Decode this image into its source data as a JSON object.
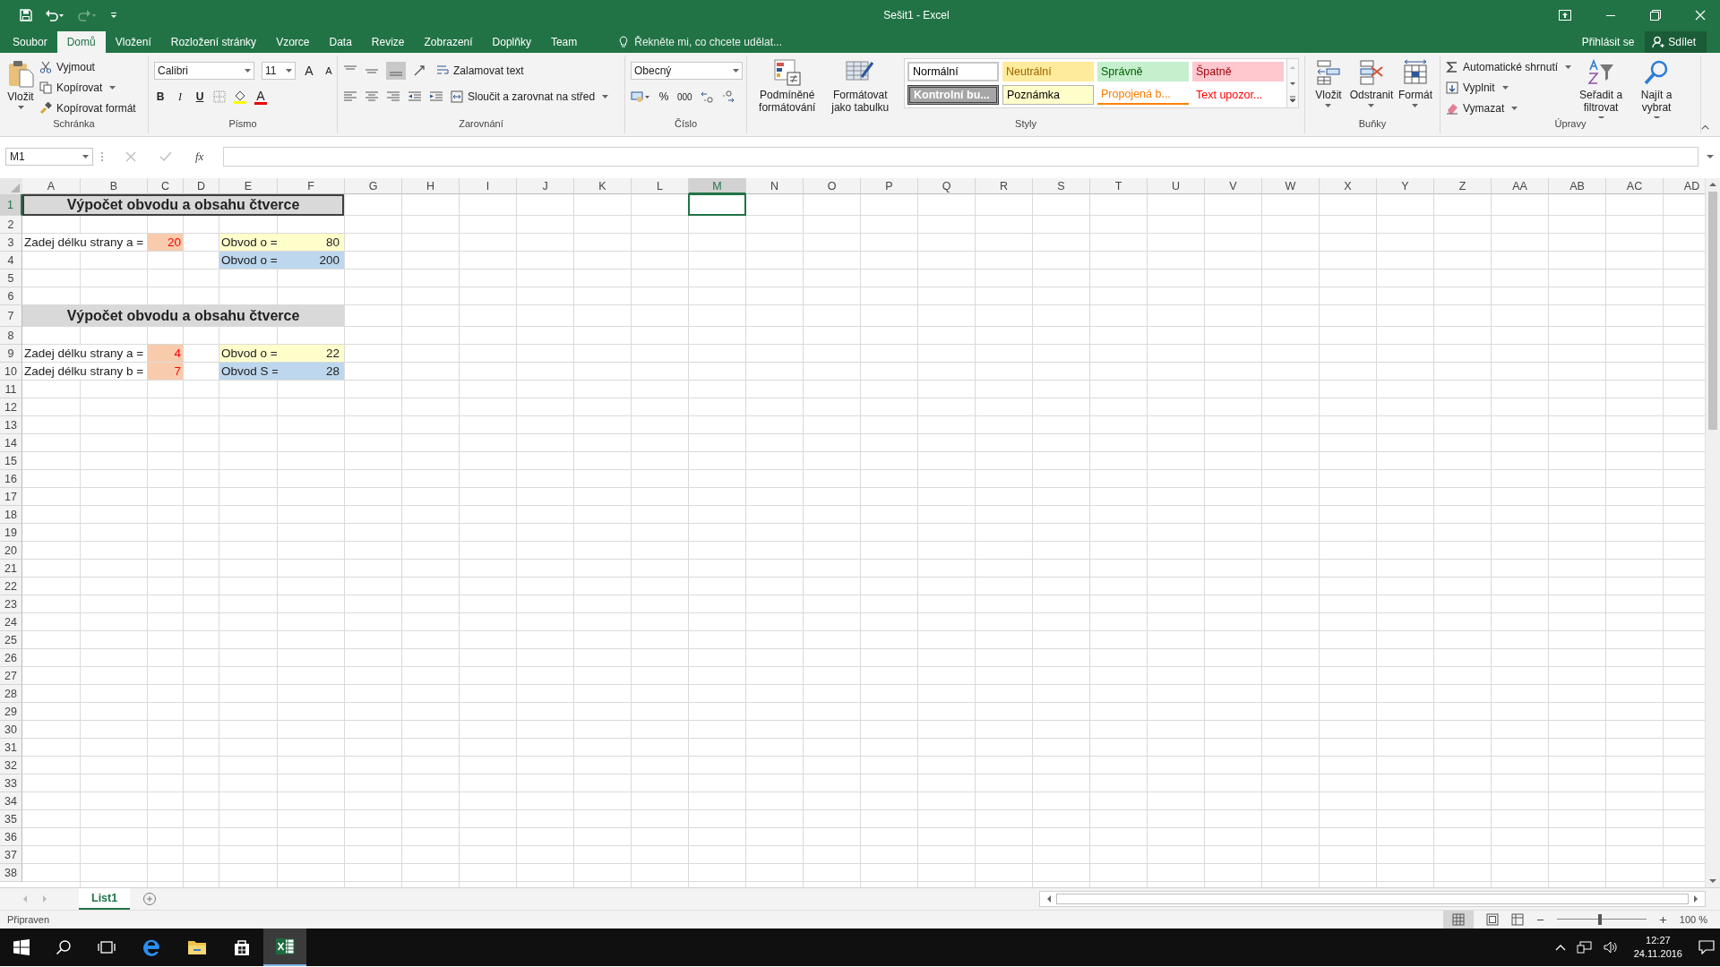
{
  "window": {
    "title": "Sešit1 - Excel"
  },
  "tabs": [
    {
      "label": "Soubor",
      "selected": false
    },
    {
      "label": "Domů",
      "selected": true
    },
    {
      "label": "Vložení",
      "selected": false
    },
    {
      "label": "Rozložení stránky",
      "selected": false
    },
    {
      "label": "Vzorce",
      "selected": false
    },
    {
      "label": "Data",
      "selected": false
    },
    {
      "label": "Revize",
      "selected": false
    },
    {
      "label": "Zobrazení",
      "selected": false
    },
    {
      "label": "Doplňky",
      "selected": false
    },
    {
      "label": "Team",
      "selected": false
    }
  ],
  "tell_me": {
    "placeholder": "Řekněte mi, co chcete udělat..."
  },
  "account": {
    "sign_in": "Přihlásit se",
    "share": "Sdílet"
  },
  "ribbon": {
    "clipboard": {
      "label": "Schránka",
      "paste": "Vložit",
      "cut": "Vyjmout",
      "copy": "Kopírovat",
      "format_painter": "Kopírovat formát"
    },
    "font": {
      "label": "Písmo",
      "font": "Calibri",
      "size": "11",
      "grow": "A",
      "shrink": "A",
      "bold": "B",
      "italic": "I",
      "underline": "U",
      "font_color": "A"
    },
    "alignment": {
      "label": "Zarovnání",
      "wrap": "Zalamovat text",
      "merge": "Sloučit a zarovnat na střed"
    },
    "number": {
      "label": "Číslo",
      "format": "Obecný",
      "percent": "%",
      "thousands": "000"
    },
    "styles": {
      "label": "Styly",
      "conditional": "Podmíněné formátování",
      "as_table": "Formátovat jako tabulku",
      "cell_styles": [
        {
          "label": "Normální",
          "kind": "normal"
        },
        {
          "label": "Neutrální",
          "kind": "neutral"
        },
        {
          "label": "Správně",
          "kind": "good"
        },
        {
          "label": "Špatně",
          "kind": "bad"
        },
        {
          "label": "Kontrolní bu...",
          "kind": "check"
        },
        {
          "label": "Poznámka",
          "kind": "note"
        },
        {
          "label": "Propojená b...",
          "kind": "linked"
        },
        {
          "label": "Text upozor...",
          "kind": "warning"
        }
      ]
    },
    "cells": {
      "label": "Buňky",
      "insert": "Vložit",
      "delete": "Odstranit",
      "format": "Formát"
    },
    "editing": {
      "label": "Úpravy",
      "autosum": "Automatické shrnutí",
      "fill": "Vyplnit",
      "clear": "Vymazat",
      "sort": "Seřadit a filtrovat",
      "find": "Najít a vybrat"
    }
  },
  "formula_bar": {
    "name_box": "M1",
    "fx": "fx"
  },
  "sheet": {
    "columns": [
      {
        "label": "A",
        "selected": false
      },
      {
        "label": "B",
        "selected": false
      },
      {
        "label": "C",
        "selected": false
      },
      {
        "label": "D",
        "selected": false
      },
      {
        "label": "E",
        "selected": false
      },
      {
        "label": "F",
        "selected": false
      },
      {
        "label": "G",
        "selected": false
      },
      {
        "label": "H",
        "selected": false
      },
      {
        "label": "I",
        "selected": false
      },
      {
        "label": "J",
        "selected": false
      },
      {
        "label": "K",
        "selected": false
      },
      {
        "label": "L",
        "selected": false
      },
      {
        "label": "M",
        "selected": true
      },
      {
        "label": "N",
        "selected": false
      },
      {
        "label": "O",
        "selected": false
      },
      {
        "label": "P",
        "selected": false
      },
      {
        "label": "Q",
        "selected": false
      },
      {
        "label": "R",
        "selected": false
      },
      {
        "label": "S",
        "selected": false
      },
      {
        "label": "T",
        "selected": false
      },
      {
        "label": "U",
        "selected": false
      },
      {
        "label": "V",
        "selected": false
      },
      {
        "label": "W",
        "selected": false
      },
      {
        "label": "X",
        "selected": false
      },
      {
        "label": "Y",
        "selected": false
      },
      {
        "label": "Z",
        "selected": false
      },
      {
        "label": "AA",
        "selected": false
      },
      {
        "label": "AB",
        "selected": false
      },
      {
        "label": "AC",
        "selected": false
      },
      {
        "label": "AD",
        "selected": false
      }
    ],
    "rows": [
      {
        "number": "1",
        "selected": true,
        "cells": [
          {
            "kind": "heading",
            "framed": true,
            "text": "Výpočet obvodu a obsahu čtverce"
          }
        ]
      },
      {
        "number": "2",
        "selected": false
      },
      {
        "number": "3",
        "selected": false,
        "cells": [
          {
            "kind": "prompt",
            "text": "Zadej délku strany a ="
          },
          {
            "kind": "input",
            "text": "20"
          },
          {
            "kind": "result_name",
            "text": "Obvod o =",
            "color": "#ffffcc"
          },
          {
            "kind": "result_value",
            "text": "80",
            "color": "#ffffcc"
          }
        ]
      },
      {
        "number": "4",
        "selected": false,
        "cells": [
          {
            "kind": "result_name",
            "text": "Obvod o =",
            "color": "#bdd7ee"
          },
          {
            "kind": "result_value",
            "text": "200",
            "color": "#bdd7ee"
          }
        ]
      },
      {
        "number": "5",
        "selected": false
      },
      {
        "number": "6",
        "selected": false
      },
      {
        "number": "7",
        "selected": false,
        "cells": [
          {
            "kind": "heading",
            "framed": false,
            "text": "Výpočet obvodu a obsahu čtverce"
          }
        ]
      },
      {
        "number": "8",
        "selected": false
      },
      {
        "number": "9",
        "selected": false,
        "cells": [
          {
            "kind": "prompt",
            "text": "Zadej délku strany a ="
          },
          {
            "kind": "input",
            "text": "4"
          },
          {
            "kind": "result_name",
            "text": "Obvod o =",
            "color": "#ffffcc"
          },
          {
            "kind": "result_value",
            "text": "22",
            "color": "#ffffcc"
          }
        ]
      },
      {
        "number": "10",
        "selected": false,
        "cells": [
          {
            "kind": "prompt",
            "text": "Zadej délku strany b ="
          },
          {
            "kind": "input",
            "text": "7"
          },
          {
            "kind": "result_name",
            "text": "Obvod S =",
            "color": "#bdd7ee"
          },
          {
            "kind": "result_value",
            "text": "28",
            "color": "#bdd7ee"
          }
        ]
      },
      {
        "number": "11",
        "selected": false
      },
      {
        "number": "12",
        "selected": false
      },
      {
        "number": "13",
        "selected": false
      },
      {
        "number": "14",
        "selected": false
      },
      {
        "number": "15",
        "selected": false
      },
      {
        "number": "16",
        "selected": false
      },
      {
        "number": "17",
        "selected": false
      },
      {
        "number": "18",
        "selected": false
      },
      {
        "number": "19",
        "selected": false
      },
      {
        "number": "20",
        "selected": false
      },
      {
        "number": "21",
        "selected": false
      },
      {
        "number": "22",
        "selected": false
      },
      {
        "number": "23",
        "selected": false
      },
      {
        "number": "24",
        "selected": false
      },
      {
        "number": "25",
        "selected": false
      },
      {
        "number": "26",
        "selected": false
      },
      {
        "number": "27",
        "selected": false
      },
      {
        "number": "28",
        "selected": false
      },
      {
        "number": "29",
        "selected": false
      },
      {
        "number": "30",
        "selected": false
      },
      {
        "number": "31",
        "selected": false
      },
      {
        "number": "32",
        "selected": false
      },
      {
        "number": "33",
        "selected": false
      },
      {
        "number": "34",
        "selected": false
      },
      {
        "number": "35",
        "selected": false
      },
      {
        "number": "36",
        "selected": false
      },
      {
        "number": "37",
        "selected": false
      },
      {
        "number": "38",
        "selected": false
      }
    ]
  },
  "sheet_tabs": [
    {
      "label": "List1",
      "selected": true
    }
  ],
  "status_bar": {
    "status": "Připraven",
    "zoom": "100 %",
    "level": 0.5
  },
  "taskbar": {
    "time": "12:27",
    "date": "24.11.2016"
  }
}
